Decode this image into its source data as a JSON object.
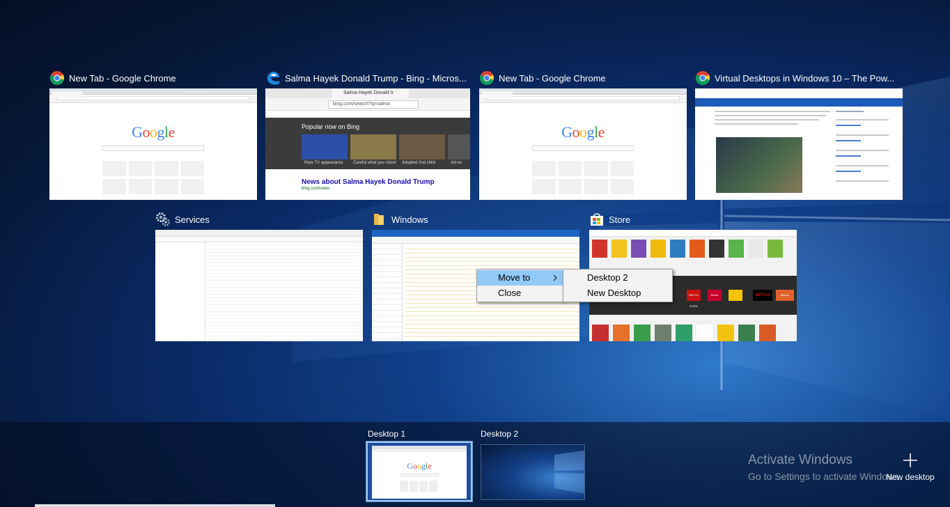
{
  "windows": [
    {
      "title": "New Tab - Google Chrome",
      "app": "chrome-icon"
    },
    {
      "title": "Salma Hayek Donald Trump - Bing - Micros...",
      "app": "edge-icon",
      "tab_label": "Salma Hayek Donald tr",
      "address": "bing.com/search?q=salma",
      "carousel_title": "Popular now on Bing",
      "captions": [
        "Rare TV appearance",
        "Careful what you shoot",
        "Adopted 2nd child",
        "Ad-no"
      ],
      "news_title": "News about Salma Hayek Donald Trump",
      "news_source": "bing.com/news"
    },
    {
      "title": "New Tab - Google Chrome",
      "app": "chrome-icon"
    },
    {
      "title": "Virtual Desktops in Windows 10 – The Pow...",
      "app": "chrome-icon"
    },
    {
      "title": "Services",
      "app": "gears-icon"
    },
    {
      "title": "Windows",
      "app": "folder-icon"
    },
    {
      "title": "Store",
      "app": "store-icon",
      "tiles": [
        "WATCH ESPN",
        "iHeart",
        "NETFLIX",
        "dbaron"
      ]
    }
  ],
  "google_logo": [
    "G",
    "o",
    "o",
    "g",
    "l",
    "e"
  ],
  "context_menu": {
    "items": [
      "Move to",
      "Close"
    ],
    "submenu": [
      "Desktop 2",
      "New Desktop"
    ]
  },
  "desktops": [
    {
      "label": "Desktop 1",
      "active": true
    },
    {
      "label": "Desktop 2",
      "active": false
    }
  ],
  "new_desktop": {
    "label": "New desktop"
  },
  "watermark": {
    "line1": "Activate Windows",
    "line2": "Go to Settings to activate Windows."
  },
  "colors": {
    "accent_blue": "#1e5bb8",
    "menu_highlight": "#91c9f7",
    "desktop_bg": "#0a2a66"
  }
}
